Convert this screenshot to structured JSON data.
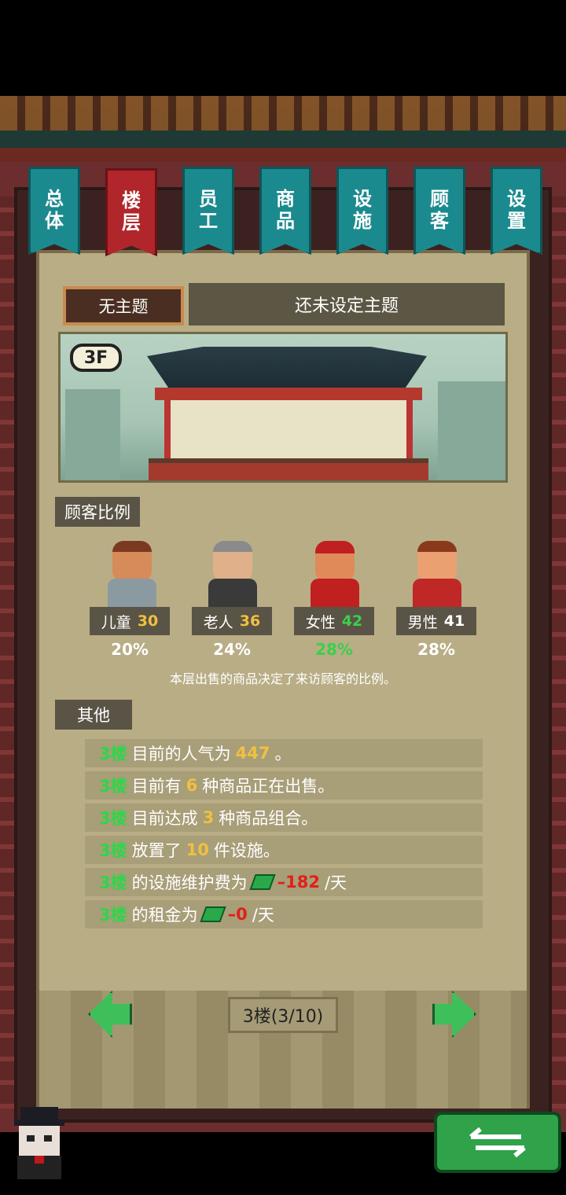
{
  "tabs": [
    {
      "label": "总\n体",
      "active": false
    },
    {
      "label": "楼\n层",
      "active": true
    },
    {
      "label": "员\n工",
      "active": false
    },
    {
      "label": "商\n品",
      "active": false
    },
    {
      "label": "设\n施",
      "active": false
    },
    {
      "label": "顾\n客",
      "active": false
    },
    {
      "label": "设\n置",
      "active": false
    }
  ],
  "theme": {
    "button": "无主题",
    "description": "还未设定主题"
  },
  "floor_badge": "3F",
  "customer_section": {
    "title": "顾客比例",
    "types": [
      {
        "label": "儿童",
        "count": "30",
        "percent": "20%",
        "highlight": false
      },
      {
        "label": "老人",
        "count": "36",
        "percent": "24%",
        "highlight": false
      },
      {
        "label": "女性",
        "count": "42",
        "percent": "28%",
        "highlight": true
      },
      {
        "label": "男性",
        "count": "41",
        "percent": "28%",
        "highlight": false
      }
    ],
    "note": "本层出售的商品决定了来访顾客的比例。"
  },
  "other_section": {
    "title": "其他",
    "floor_name": "3楼",
    "stats": [
      {
        "pre": "目前的人气为",
        "value": "447",
        "post": "。"
      },
      {
        "pre": "目前有",
        "value": "6",
        "post": "种商品正在出售。"
      },
      {
        "pre": "目前达成",
        "value": "3",
        "post": "种商品组合。"
      },
      {
        "pre": "放置了",
        "value": "10",
        "post": "件设施。"
      },
      {
        "pre": "的设施维护费为",
        "value": "–182",
        "post": "/天",
        "money": true
      },
      {
        "pre": "的租金为",
        "value": "–0",
        "post": "/天",
        "money": true
      }
    ]
  },
  "pager": {
    "label": "3楼(3/10)"
  },
  "icons": {
    "prev": "left-arrow-icon",
    "next": "right-arrow-icon",
    "back": "back-icon",
    "cash": "cash-icon"
  }
}
